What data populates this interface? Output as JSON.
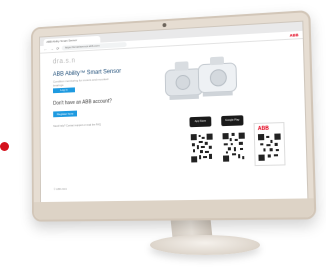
{
  "browser": {
    "tab_title": "ABB Ability Smart Sensor",
    "url": "https://smartsensor.abb.com"
  },
  "header": {
    "logo": "ABB"
  },
  "page": {
    "brand": "dra.s.n",
    "app_title": "ABB Ability™ Smart Sensor",
    "tagline": "Condition monitoring for motors and mounted bearings",
    "login_label": "Log in",
    "register_question": "Don't have an ABB account?",
    "register_label": "Register here",
    "fineprint": "Need help? Contact support or read the FAQ",
    "footer": "© ABB 2019"
  },
  "stores": {
    "apple": "App Store",
    "google": "Google Play"
  },
  "card": {
    "logo": "ABB"
  },
  "colors": {
    "accent": "#1e9ae0",
    "brand_red": "#e2001a",
    "dot_red": "#d4111c"
  }
}
